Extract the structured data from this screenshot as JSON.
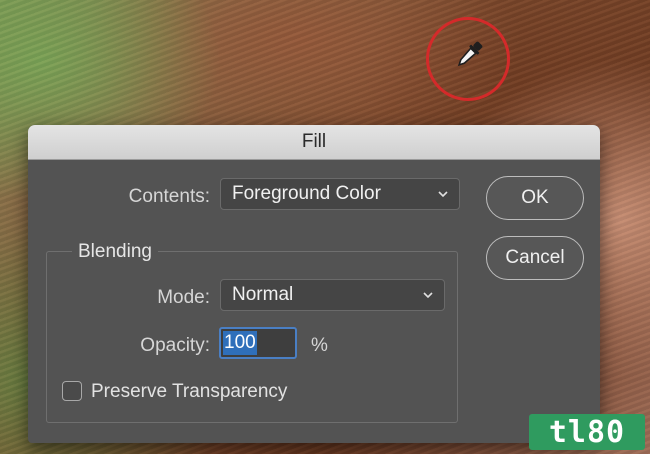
{
  "dialog": {
    "title": "Fill",
    "contents_label": "Contents:",
    "contents_value": "Foreground Color",
    "ok_label": "OK",
    "cancel_label": "Cancel"
  },
  "blending": {
    "group_title": "Blending",
    "mode_label": "Mode:",
    "mode_value": "Normal",
    "opacity_label": "Opacity:",
    "opacity_value": "100",
    "opacity_unit": "%",
    "preserve_label": "Preserve Transparency",
    "preserve_checked": false
  },
  "watermark": {
    "text": "tl80"
  },
  "colors": {
    "cursor_ring": "#d42a2a",
    "selection": "#2f6fba",
    "watermark_bg": "#2f9b5f"
  },
  "icons": [
    "eyedropper-icon",
    "chevron-down-icon"
  ]
}
